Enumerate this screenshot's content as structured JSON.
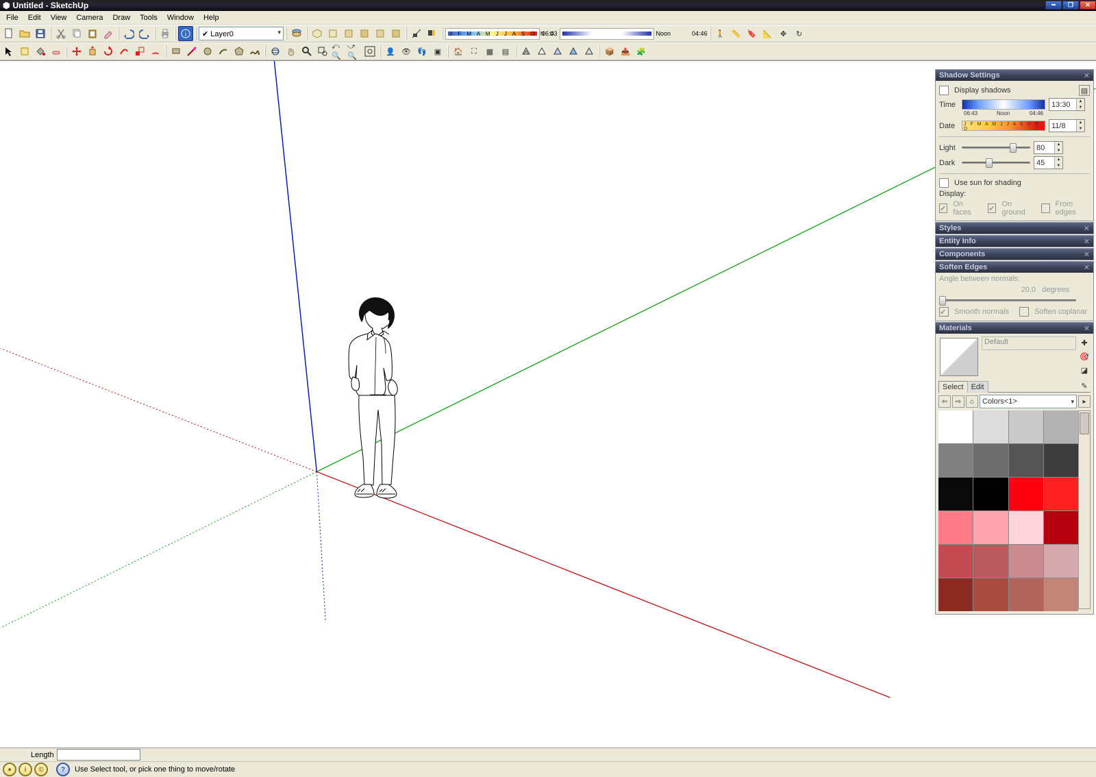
{
  "title": "Untitled - SketchUp",
  "menu": [
    "File",
    "Edit",
    "View",
    "Camera",
    "Draw",
    "Tools",
    "Window",
    "Help"
  ],
  "layer": "Layer0",
  "time_start": "06:43",
  "time_noon": "Noon",
  "time_end": "04:46",
  "monthletters": "J F M A M J J A S O N D",
  "panels": {
    "shadow": {
      "title": "Shadow Settings",
      "display_shadows": "Display shadows",
      "time_label": "Time",
      "time_value": "13:30",
      "time_start": "06:43",
      "time_noon": "Noon",
      "time_end": "04:46",
      "date_label": "Date",
      "date_months": "J F M A M J J A S O N D",
      "date_value": "11/8",
      "light_label": "Light",
      "light_value": "80",
      "dark_label": "Dark",
      "dark_value": "45",
      "use_sun": "Use sun for shading",
      "display_label": "Display:",
      "on_faces": "On faces",
      "on_ground": "On ground",
      "from_edges": "From edges"
    },
    "styles": "Styles",
    "entity": "Entity Info",
    "components": "Components",
    "soften": {
      "title": "Soften Edges",
      "angle": "Angle between normals:",
      "angle_val": "20,0",
      "angle_unit": "degrees",
      "smooth": "Smooth normals",
      "coplanar": "Soften coplanar"
    },
    "materials": {
      "title": "Materials",
      "default": "Default",
      "select": "Select",
      "edit": "Edit",
      "collection": "Colors<1>"
    }
  },
  "swatches": [
    "#ffffff",
    "#dcdcdc",
    "#c9c9c9",
    "#b3b3b3",
    "#808080",
    "#6e6e6e",
    "#555555",
    "#3c3c3c",
    "#0a0a0a",
    "#000000",
    "#ff0010",
    "#ff2020",
    "#ff7b88",
    "#ffa4af",
    "#ffd4da",
    "#b50010",
    "#c14b51",
    "#b95a5f",
    "#c98b8f",
    "#d5a9ad",
    "#8b2a20",
    "#a84b3e",
    "#b2655a",
    "#c48579"
  ],
  "status": {
    "length_label": "Length",
    "hint": "Use Select tool, or pick one thing to move/rotate"
  }
}
